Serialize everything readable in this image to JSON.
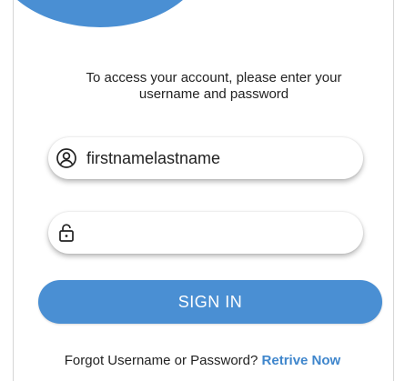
{
  "colors": {
    "accent": "#4a8fd3",
    "link": "#3f86cc",
    "text": "#222222"
  },
  "instructions": {
    "line1": "To access your account, please enter your",
    "line2": "username and password"
  },
  "username_field": {
    "icon": "user-circle-icon",
    "value": "firstnamelastname"
  },
  "password_field": {
    "icon": "lock-icon",
    "value": ""
  },
  "signin_button": {
    "label": "SIGN IN"
  },
  "forgot": {
    "prompt": "Forgot Username or Password?",
    "link_label": "Retrive Now"
  }
}
